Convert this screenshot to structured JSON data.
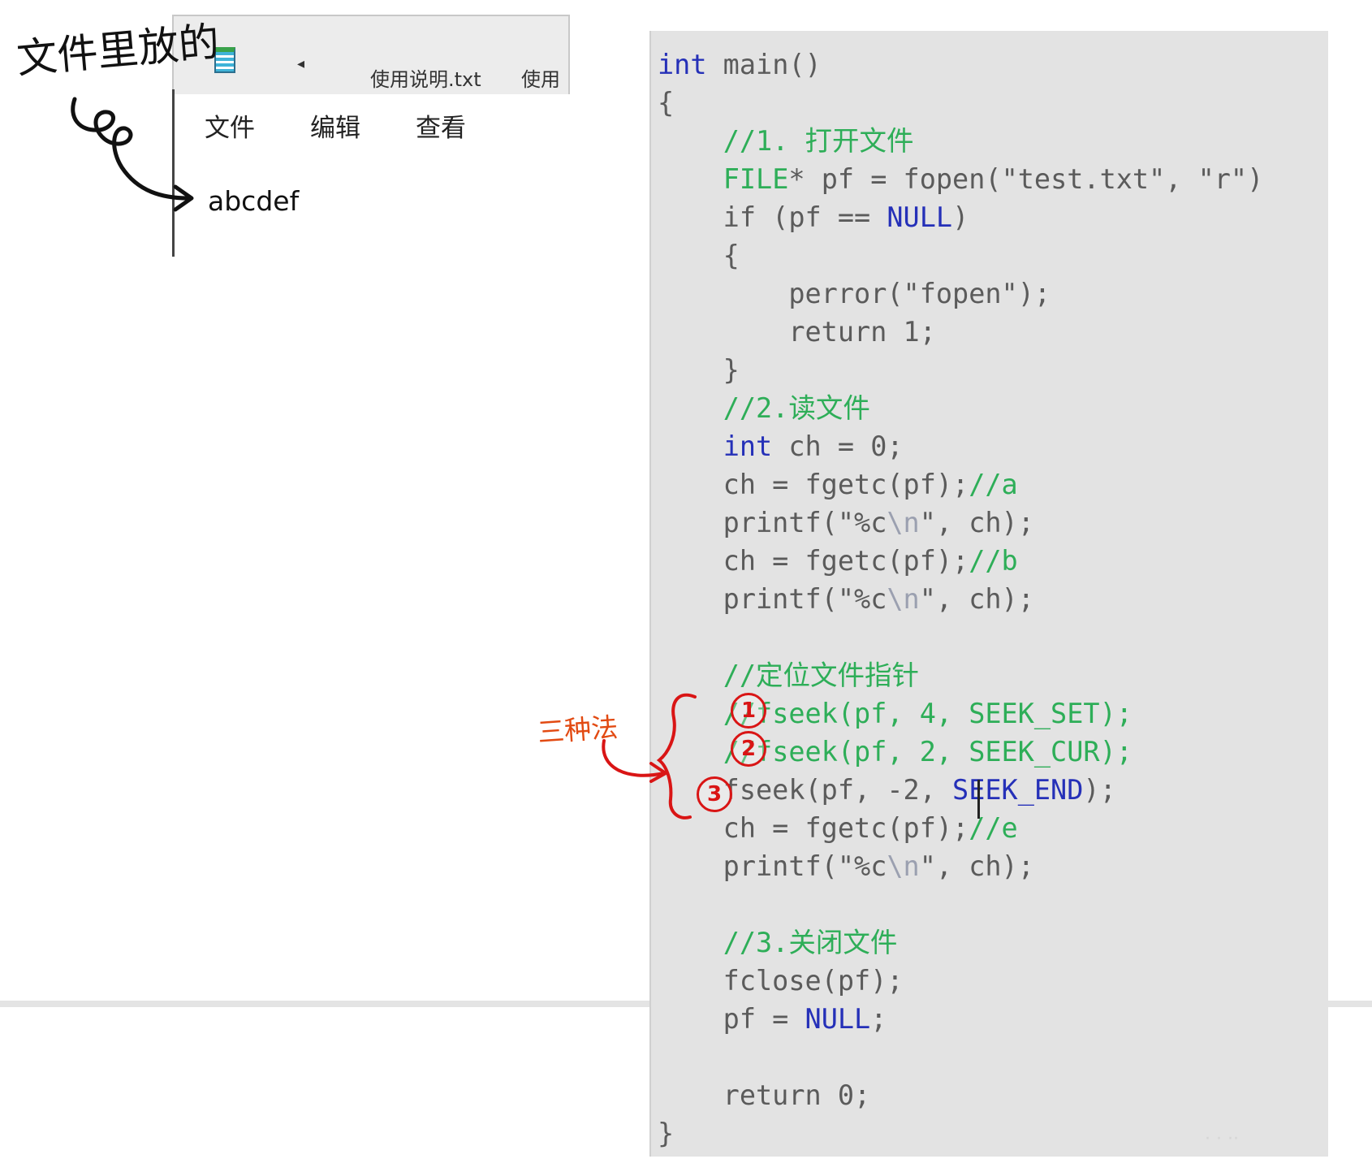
{
  "handwritten_note": "文件里放的",
  "notepad": {
    "tabs": [
      "使用说明.txt",
      "使用"
    ],
    "menu": [
      "文件",
      "编辑",
      "查看"
    ],
    "content": "abcdef"
  },
  "code_lines": [
    [
      {
        "t": "int",
        "c": "kw"
      },
      {
        "t": " main()"
      }
    ],
    [
      {
        "t": "{"
      }
    ],
    [
      {
        "t": "    "
      },
      {
        "t": "//1. 打开文件",
        "c": "cm"
      }
    ],
    [
      {
        "t": "    "
      },
      {
        "t": "FILE",
        "c": "cm"
      },
      {
        "t": "* pf = fopen(\"test.txt\", \"r\")"
      }
    ],
    [
      {
        "t": "    if (pf == "
      },
      {
        "t": "NULL",
        "c": "mc"
      },
      {
        "t": ")"
      }
    ],
    [
      {
        "t": "    {"
      }
    ],
    [
      {
        "t": "        perror(\"fopen\");"
      }
    ],
    [
      {
        "t": "        return 1;"
      }
    ],
    [
      {
        "t": "    }"
      }
    ],
    [
      {
        "t": "    "
      },
      {
        "t": "//2.读文件",
        "c": "cm"
      }
    ],
    [
      {
        "t": "    "
      },
      {
        "t": "int",
        "c": "kw"
      },
      {
        "t": " ch = 0;"
      }
    ],
    [
      {
        "t": "    ch = fgetc(pf);"
      },
      {
        "t": "//a",
        "c": "cm"
      }
    ],
    [
      {
        "t": "    printf(\"%c"
      },
      {
        "t": "\\n",
        "c": "esc"
      },
      {
        "t": "\", ch);"
      }
    ],
    [
      {
        "t": "    ch = fgetc(pf);"
      },
      {
        "t": "//b",
        "c": "cm"
      }
    ],
    [
      {
        "t": "    printf(\"%c"
      },
      {
        "t": "\\n",
        "c": "esc"
      },
      {
        "t": "\", ch);"
      }
    ],
    [
      {
        "t": ""
      }
    ],
    [
      {
        "t": "    "
      },
      {
        "t": "//定位文件指针",
        "c": "cm"
      }
    ],
    [
      {
        "t": "    "
      },
      {
        "t": "//fseek(pf, 4, SEEK_SET);",
        "c": "seek"
      }
    ],
    [
      {
        "t": "    "
      },
      {
        "t": "//fseek(pf, 2, SEEK_CUR);",
        "c": "seek"
      }
    ],
    [
      {
        "t": "    fseek(pf, -2, "
      },
      {
        "t": "SEEK_END",
        "c": "mc"
      },
      {
        "t": ");"
      }
    ],
    [
      {
        "t": "    ch = fgetc(pf);"
      },
      {
        "t": "//e",
        "c": "cm"
      }
    ],
    [
      {
        "t": "    printf(\"%c"
      },
      {
        "t": "\\n",
        "c": "esc"
      },
      {
        "t": "\", ch);"
      }
    ],
    [
      {
        "t": ""
      }
    ],
    [
      {
        "t": "    "
      },
      {
        "t": "//3.关闭文件",
        "c": "cm"
      }
    ],
    [
      {
        "t": "    fclose(pf);"
      }
    ],
    [
      {
        "t": "    pf = "
      },
      {
        "t": "NULL",
        "c": "mc"
      },
      {
        "t": ";"
      }
    ],
    [
      {
        "t": ""
      }
    ],
    [
      {
        "t": "    return 0;"
      }
    ],
    [
      {
        "t": "}"
      }
    ]
  ],
  "annotation": {
    "label": "三种法",
    "markers": [
      "1",
      "2",
      "3"
    ]
  },
  "colors": {
    "keyword": "#2530b8",
    "comment": "#2eae58",
    "annotation": "#d91515"
  }
}
